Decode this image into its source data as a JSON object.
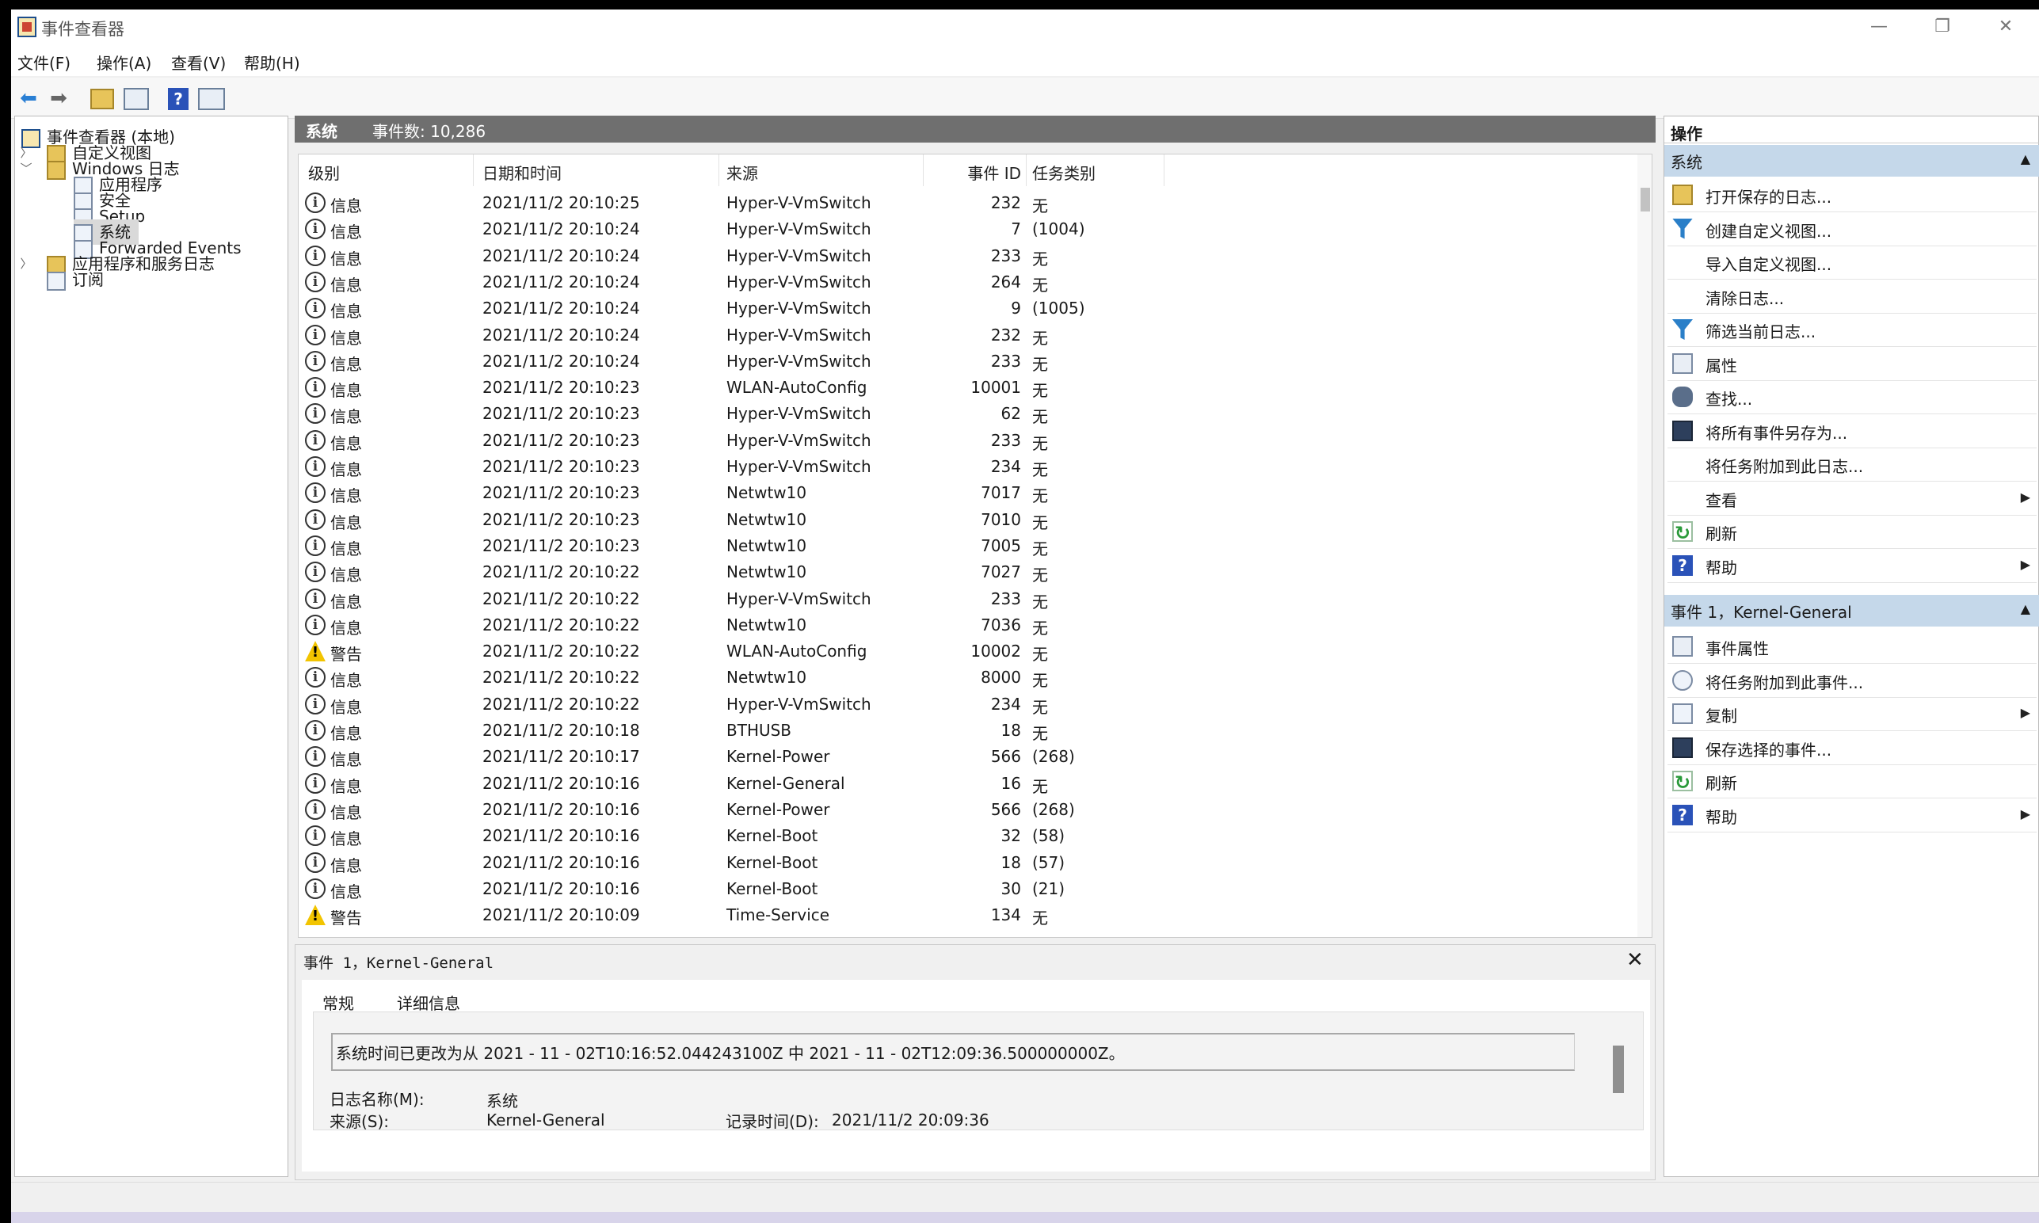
{
  "window": {
    "title": "事件查看器",
    "minimize": "—",
    "maximize": "❐",
    "close": "✕"
  },
  "menu": [
    "文件(F)",
    "操作(A)",
    "查看(V)",
    "帮助(H)"
  ],
  "toolbar": {
    "help": "?"
  },
  "tree": {
    "root": "事件查看器 (本地)",
    "custom_views": "自定义视图",
    "windows_logs": "Windows 日志",
    "logs": [
      "应用程序",
      "安全",
      "Setup",
      "系统",
      "Forwarded Events"
    ],
    "app_service_logs": "应用程序和服务日志",
    "subscriptions": "订阅"
  },
  "center": {
    "log_name": "系统",
    "event_count": "事件数: 10,286"
  },
  "columns": {
    "level": "级别",
    "datetime": "日期和时间",
    "source": "来源",
    "event_id": "事件 ID",
    "task": "任务类别"
  },
  "events": [
    {
      "level": "信息",
      "time": "2021/11/2 20:10:25",
      "source": "Hyper-V-VmSwitch",
      "id": "232",
      "task": "无",
      "warn": false
    },
    {
      "level": "信息",
      "time": "2021/11/2 20:10:24",
      "source": "Hyper-V-VmSwitch",
      "id": "7",
      "task": "(1004)",
      "warn": false
    },
    {
      "level": "信息",
      "time": "2021/11/2 20:10:24",
      "source": "Hyper-V-VmSwitch",
      "id": "233",
      "task": "无",
      "warn": false
    },
    {
      "level": "信息",
      "time": "2021/11/2 20:10:24",
      "source": "Hyper-V-VmSwitch",
      "id": "264",
      "task": "无",
      "warn": false
    },
    {
      "level": "信息",
      "time": "2021/11/2 20:10:24",
      "source": "Hyper-V-VmSwitch",
      "id": "9",
      "task": "(1005)",
      "warn": false
    },
    {
      "level": "信息",
      "time": "2021/11/2 20:10:24",
      "source": "Hyper-V-VmSwitch",
      "id": "232",
      "task": "无",
      "warn": false
    },
    {
      "level": "信息",
      "time": "2021/11/2 20:10:24",
      "source": "Hyper-V-VmSwitch",
      "id": "233",
      "task": "无",
      "warn": false
    },
    {
      "level": "信息",
      "time": "2021/11/2 20:10:23",
      "source": "WLAN-AutoConfig",
      "id": "10001",
      "task": "无",
      "warn": false
    },
    {
      "level": "信息",
      "time": "2021/11/2 20:10:23",
      "source": "Hyper-V-VmSwitch",
      "id": "62",
      "task": "无",
      "warn": false
    },
    {
      "level": "信息",
      "time": "2021/11/2 20:10:23",
      "source": "Hyper-V-VmSwitch",
      "id": "233",
      "task": "无",
      "warn": false
    },
    {
      "level": "信息",
      "time": "2021/11/2 20:10:23",
      "source": "Hyper-V-VmSwitch",
      "id": "234",
      "task": "无",
      "warn": false
    },
    {
      "level": "信息",
      "time": "2021/11/2 20:10:23",
      "source": "Netwtw10",
      "id": "7017",
      "task": "无",
      "warn": false
    },
    {
      "level": "信息",
      "time": "2021/11/2 20:10:23",
      "source": "Netwtw10",
      "id": "7010",
      "task": "无",
      "warn": false
    },
    {
      "level": "信息",
      "time": "2021/11/2 20:10:23",
      "source": "Netwtw10",
      "id": "7005",
      "task": "无",
      "warn": false
    },
    {
      "level": "信息",
      "time": "2021/11/2 20:10:22",
      "source": "Netwtw10",
      "id": "7027",
      "task": "无",
      "warn": false
    },
    {
      "level": "信息",
      "time": "2021/11/2 20:10:22",
      "source": "Hyper-V-VmSwitch",
      "id": "233",
      "task": "无",
      "warn": false
    },
    {
      "level": "信息",
      "time": "2021/11/2 20:10:22",
      "source": "Netwtw10",
      "id": "7036",
      "task": "无",
      "warn": false
    },
    {
      "level": "警告",
      "time": "2021/11/2 20:10:22",
      "source": "WLAN-AutoConfig",
      "id": "10002",
      "task": "无",
      "warn": true
    },
    {
      "level": "信息",
      "time": "2021/11/2 20:10:22",
      "source": "Netwtw10",
      "id": "8000",
      "task": "无",
      "warn": false
    },
    {
      "level": "信息",
      "time": "2021/11/2 20:10:22",
      "source": "Hyper-V-VmSwitch",
      "id": "234",
      "task": "无",
      "warn": false
    },
    {
      "level": "信息",
      "time": "2021/11/2 20:10:18",
      "source": "BTHUSB",
      "id": "18",
      "task": "无",
      "warn": false
    },
    {
      "level": "信息",
      "time": "2021/11/2 20:10:17",
      "source": "Kernel-Power",
      "id": "566",
      "task": "(268)",
      "warn": false
    },
    {
      "level": "信息",
      "time": "2021/11/2 20:10:16",
      "source": "Kernel-General",
      "id": "16",
      "task": "无",
      "warn": false
    },
    {
      "level": "信息",
      "time": "2021/11/2 20:10:16",
      "source": "Kernel-Power",
      "id": "566",
      "task": "(268)",
      "warn": false
    },
    {
      "level": "信息",
      "time": "2021/11/2 20:10:16",
      "source": "Kernel-Boot",
      "id": "32",
      "task": "(58)",
      "warn": false
    },
    {
      "level": "信息",
      "time": "2021/11/2 20:10:16",
      "source": "Kernel-Boot",
      "id": "18",
      "task": "(57)",
      "warn": false
    },
    {
      "level": "信息",
      "time": "2021/11/2 20:10:16",
      "source": "Kernel-Boot",
      "id": "30",
      "task": "(21)",
      "warn": false
    },
    {
      "level": "警告",
      "time": "2021/11/2 20:10:09",
      "source": "Time-Service",
      "id": "134",
      "task": "无",
      "warn": true
    }
  ],
  "detail": {
    "title": "事件 1，Kernel-General",
    "close": "✕",
    "tab_general": "常规",
    "tab_details": "详细信息",
    "description": "系统时间已更改为从 2021 - 11 - 02T10:16:52.044243100Z 中 2021 - 11 - 02T12:09:36.500000000Z。",
    "log_name_label": "日志名称(M):",
    "log_name_value": "系统",
    "source_label": "来源(S):",
    "source_value": "Kernel-General",
    "logged_label": "记录时间(D):",
    "logged_value": "2021/11/2 20:09:36"
  },
  "actions": {
    "header": "操作",
    "section1": "系统",
    "section1_items": [
      {
        "label": "打开保存的日志...",
        "icon": "folder-icon",
        "submenu": false
      },
      {
        "label": "创建自定义视图...",
        "icon": "filter-icon",
        "submenu": false
      },
      {
        "label": "导入自定义视图...",
        "icon": "",
        "submenu": false
      },
      {
        "label": "清除日志...",
        "icon": "",
        "submenu": false
      },
      {
        "label": "筛选当前日志...",
        "icon": "filter-icon",
        "submenu": false
      },
      {
        "label": "属性",
        "icon": "properties-icon",
        "submenu": false
      },
      {
        "label": "查找...",
        "icon": "binoculars-icon",
        "submenu": false
      },
      {
        "label": "将所有事件另存为...",
        "icon": "save-icon",
        "submenu": false
      },
      {
        "label": "将任务附加到此日志...",
        "icon": "",
        "submenu": false
      },
      {
        "label": "查看",
        "icon": "",
        "submenu": true
      },
      {
        "label": "刷新",
        "icon": "refresh-icon",
        "submenu": false
      },
      {
        "label": "帮助",
        "icon": "help-icon",
        "submenu": true
      }
    ],
    "section2": "事件 1，Kernel-General",
    "section2_items": [
      {
        "label": "事件属性",
        "icon": "properties-icon",
        "submenu": false
      },
      {
        "label": "将任务附加到此事件...",
        "icon": "task-icon",
        "submenu": false
      },
      {
        "label": "复制",
        "icon": "copy-icon",
        "submenu": true
      },
      {
        "label": "保存选择的事件...",
        "icon": "save-icon",
        "submenu": false
      },
      {
        "label": "刷新",
        "icon": "refresh-icon",
        "submenu": false
      },
      {
        "label": "帮助",
        "icon": "help-icon",
        "submenu": true
      }
    ]
  }
}
